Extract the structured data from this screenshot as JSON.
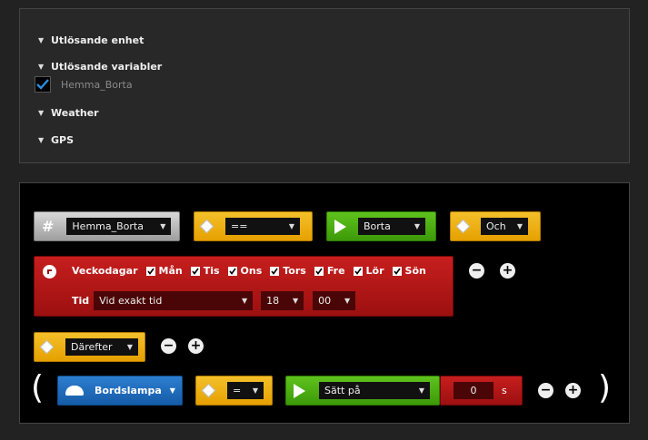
{
  "triggers_panel": {
    "items": [
      {
        "label": "Utlösande enhet"
      },
      {
        "label": "Utlösande variabler"
      },
      {
        "label": "Weather"
      },
      {
        "label": "GPS"
      }
    ],
    "variable_checkbox": {
      "label": "Hemma_Borta",
      "checked": true
    }
  },
  "rule": {
    "condition": {
      "variable_icon": "#",
      "variable": "Hemma_Borta",
      "operator": "==",
      "value": "Borta",
      "logic": "Och"
    },
    "weekday_block": {
      "label": "Veckodagar",
      "days": [
        "Mån",
        "Tis",
        "Ons",
        "Tors",
        "Fre",
        "Lör",
        "Sön"
      ],
      "time_label": "Tid",
      "time_mode": "Vid exakt tid",
      "hour": "18",
      "minute": "00"
    },
    "then_label": "Därefter",
    "action": {
      "device": "Bordslampa",
      "operator": "=",
      "command": "Sätt på",
      "delay_value": "0",
      "delay_unit": "s"
    },
    "open_paren": "(",
    "close_paren": ")",
    "minus_symbol": "−",
    "plus_symbol": "+"
  }
}
